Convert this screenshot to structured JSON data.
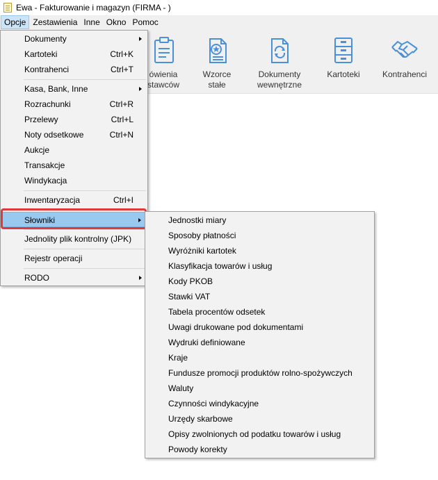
{
  "window": {
    "title": "Ewa - Fakturowanie i magazyn (FIRMA - )"
  },
  "menubar": [
    {
      "label": "Opcje",
      "hotkey_index": 0
    },
    {
      "label": "Zestawienia"
    },
    {
      "label": "Inne"
    },
    {
      "label": "Okno"
    },
    {
      "label": "Pomoc"
    }
  ],
  "toolbar": {
    "buttons": [
      {
        "line1": "ówienia",
        "line2": "stawców",
        "icon": "document-list-icon"
      },
      {
        "line1": "Wzorce",
        "line2": "stałe",
        "icon": "document-star-icon"
      },
      {
        "line1": "Dokumenty",
        "line2": "wewnętrzne",
        "icon": "document-refresh-icon"
      },
      {
        "line1": "Kartoteki",
        "line2": "",
        "icon": "cabinet-icon"
      },
      {
        "line1": "Kontrahenci",
        "line2": "",
        "icon": "handshake-icon"
      }
    ]
  },
  "options_menu": {
    "items": [
      {
        "label": "Dokumenty",
        "shortcut": "",
        "submenu": true
      },
      {
        "label": "Kartoteki",
        "shortcut": "Ctrl+K"
      },
      {
        "label": "Kontrahenci",
        "shortcut": "Ctrl+T"
      },
      {
        "label": "Kasa, Bank, Inne",
        "shortcut": "",
        "submenu": true
      },
      {
        "label": "Rozrachunki",
        "shortcut": "Ctrl+R"
      },
      {
        "label": "Przelewy",
        "shortcut": "Ctrl+L"
      },
      {
        "label": "Noty odsetkowe",
        "shortcut": "Ctrl+N"
      },
      {
        "label": "Aukcje",
        "shortcut": ""
      },
      {
        "label": "Transakcje",
        "shortcut": ""
      },
      {
        "label": "Windykacja",
        "shortcut": ""
      },
      {
        "label": "Inwentaryzacja",
        "shortcut": "Ctrl+I"
      },
      {
        "label": "Słowniki",
        "shortcut": "",
        "submenu": true,
        "highlighted": true
      },
      {
        "label": "Jednolity plik kontrolny (JPK)",
        "shortcut": ""
      },
      {
        "label": "Rejestr operacji",
        "shortcut": ""
      },
      {
        "label": "RODO",
        "shortcut": "",
        "submenu": true
      }
    ]
  },
  "dictionaries_submenu": {
    "items": [
      "Jednostki miary",
      "Sposoby płatności",
      "Wyróżniki kartotek",
      "Klasyfikacja towarów i usług",
      "Kody PKOB",
      "Stawki VAT",
      "Tabela procentów odsetek",
      "Uwagi drukowane pod dokumentami",
      "Wydruki definiowane",
      "Kraje",
      "Fundusze promocji produktów rolno-spożywczych",
      "Waluty",
      "Czynności windykacyjne",
      "Urzędy skarbowe",
      "Opisy zwolnionych od podatku towarów i usług",
      "Powody korekty"
    ]
  },
  "colors": {
    "accent": "#4a90d9",
    "highlight": "#99c9ef",
    "callout": "#e0393b"
  }
}
